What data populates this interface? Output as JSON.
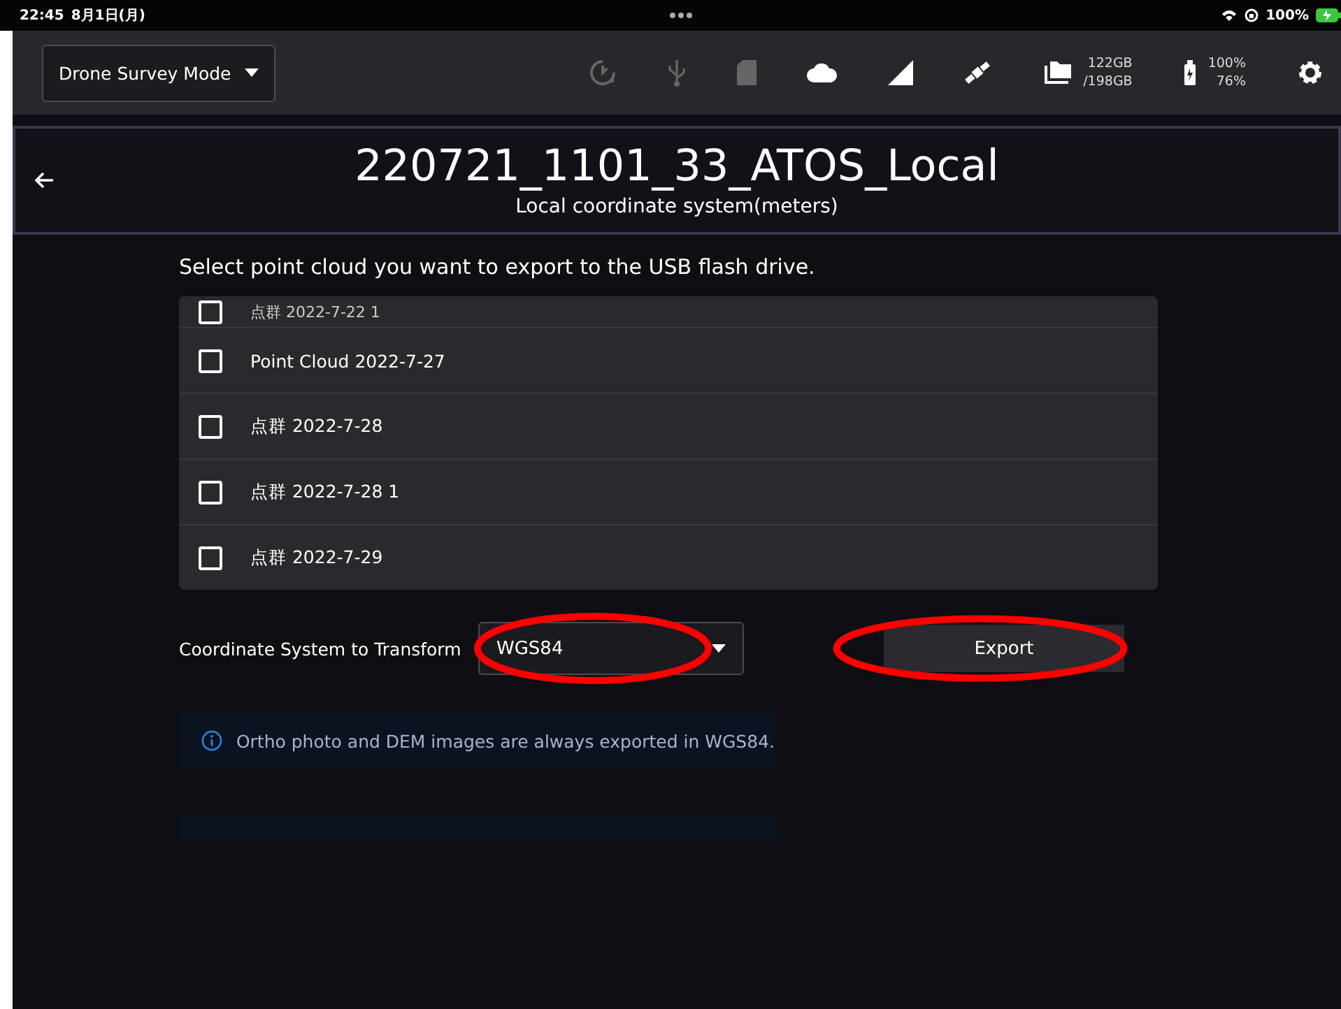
{
  "status_bar": {
    "time": "22:45",
    "date": "8月1日(月)",
    "battery": "100%"
  },
  "toolbar": {
    "mode_dropdown": "Drone Survey Mode",
    "storage": [
      "122GB",
      "/198GB"
    ],
    "power": [
      "100%",
      "76%"
    ]
  },
  "header": {
    "title": "220721_1101_33_ATOS_Local",
    "subtitle": "Local coordinate system(meters)"
  },
  "instruction": "Select point cloud you want to export to the USB flash drive.",
  "point_clouds": [
    {
      "label": "点群 2022-7-22 1",
      "checked": false
    },
    {
      "label": "Point Cloud 2022-7-27",
      "checked": false
    },
    {
      "label": "点群 2022-7-28",
      "checked": false
    },
    {
      "label": "点群 2022-7-28 1",
      "checked": false
    },
    {
      "label": "点群 2022-7-29",
      "checked": false
    }
  ],
  "coordinate_system": {
    "label": "Coordinate System to Transform",
    "value": "WGS84",
    "circled": true
  },
  "export_button": {
    "label": "Export",
    "circled": true
  },
  "info_notice": "Ortho photo and DEM images are always exported in WGS84."
}
